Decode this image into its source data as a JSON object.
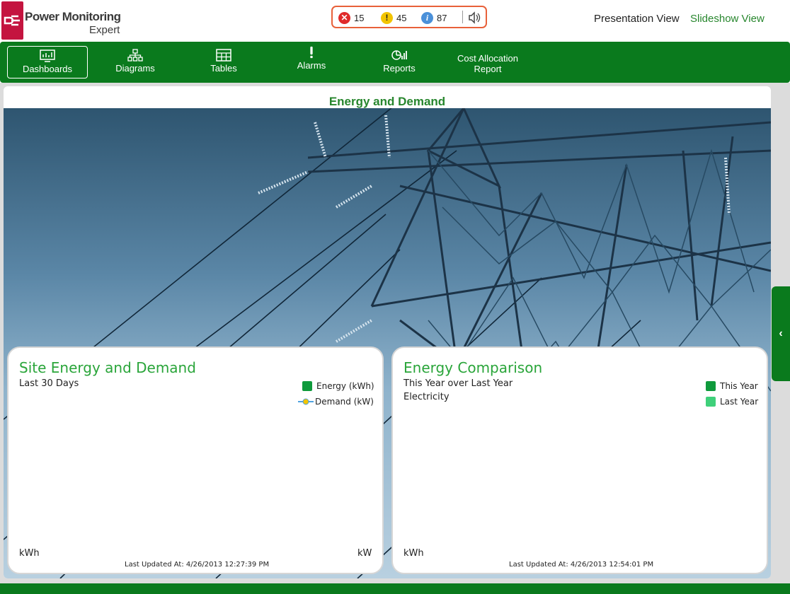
{
  "header": {
    "logo_title": "Power Monitoring",
    "logo_sub": "Expert",
    "alarms": {
      "error_count": "15",
      "warning_count": "45",
      "info_count": "87"
    },
    "presentation_view": "Presentation View",
    "slideshow_view": "Slideshow View"
  },
  "nav": {
    "items": [
      {
        "label": "Dashboards",
        "icon": "dashboard-icon"
      },
      {
        "label": "Diagrams",
        "icon": "diagram-icon"
      },
      {
        "label": "Tables",
        "icon": "table-icon"
      },
      {
        "label": "Alarms",
        "icon": "alarm-icon"
      },
      {
        "label": "Reports",
        "icon": "report-icon"
      },
      {
        "label": "Cost Allocation",
        "label2": "Report"
      }
    ]
  },
  "dashboard": {
    "title": "Energy and Demand"
  },
  "cards": {
    "site": {
      "title": "Site Energy and Demand",
      "subtitle": "Last 30 Days",
      "legend_energy": "Energy (kWh)",
      "legend_demand": "Demand (kW)",
      "left_unit": "kWh",
      "right_unit": "kW",
      "updated": "Last Updated At: 4/26/2013 12:27:39 PM"
    },
    "comparison": {
      "title": "Energy Comparison",
      "subtitle1": "This Year over Last Year",
      "subtitle2": "Electricity",
      "legend_this": "This Year",
      "legend_last": "Last Year",
      "left_unit": "kWh",
      "updated": "Last Updated At: 4/26/2013 12:54:01 PM"
    }
  },
  "colors": {
    "brand_green": "#0a7a1d",
    "title_green": "#27862d",
    "energy_swatch": "#0f9a3c",
    "last_year_swatch": "#3fd07a",
    "demand_line": "#4fa3e0",
    "demand_marker": "#f2c400",
    "logo_red": "#c4143f"
  },
  "side_tab_glyph": "‹"
}
